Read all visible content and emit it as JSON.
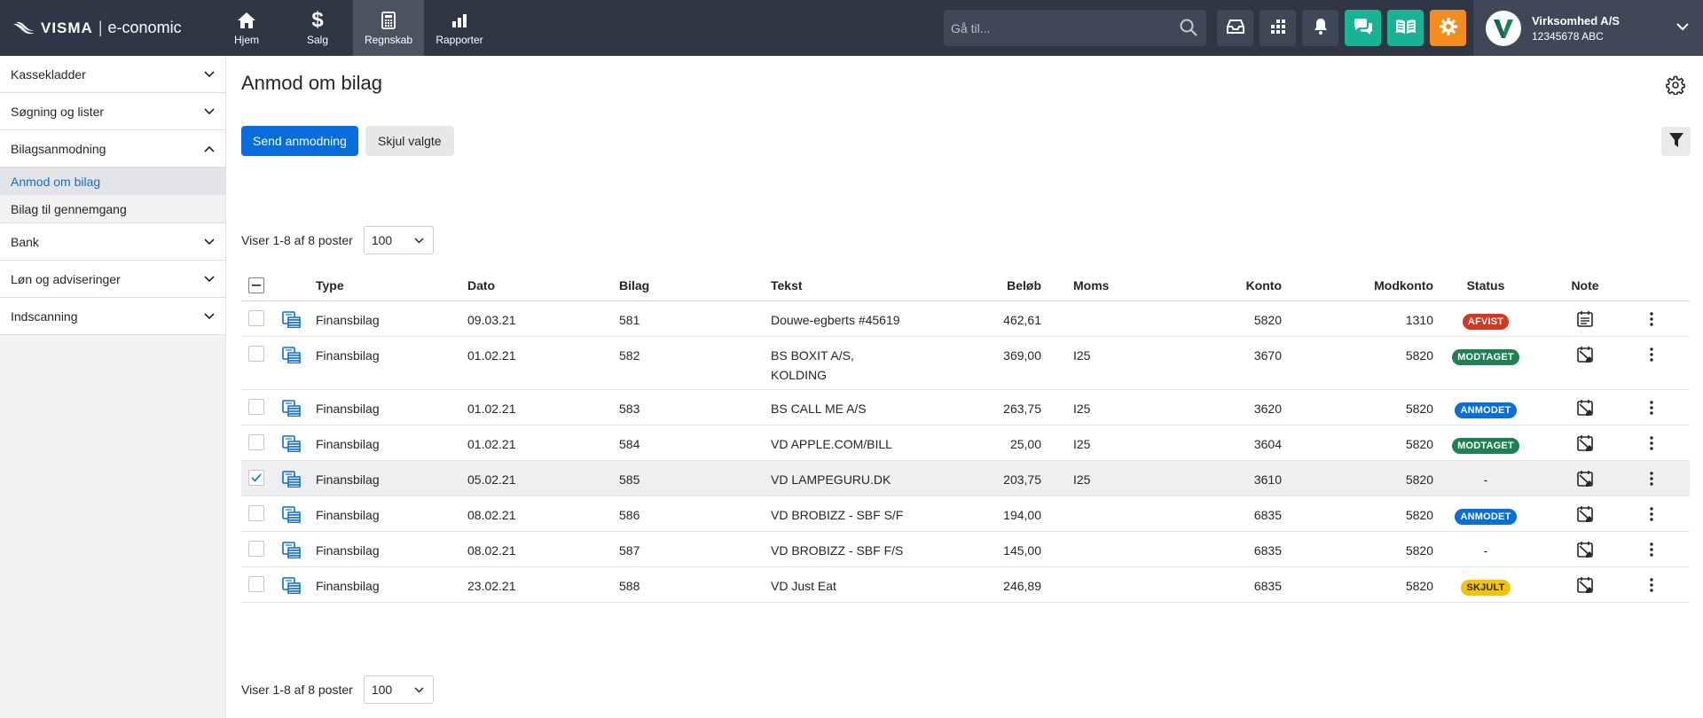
{
  "brand": {
    "visma": "VISMA",
    "sep": "|",
    "product": "e-conomic"
  },
  "topnav": [
    {
      "label": "Hjem",
      "icon": "home-icon"
    },
    {
      "label": "Salg",
      "icon": "dollar-icon"
    },
    {
      "label": "Regnskab",
      "icon": "calculator-icon",
      "active": true
    },
    {
      "label": "Rapporter",
      "icon": "bar-chart-icon"
    }
  ],
  "search": {
    "placeholder": "Gå til..."
  },
  "company": {
    "name": "Virksomhed A/S",
    "number": "12345678 ABC"
  },
  "sidebar": {
    "groups": [
      {
        "label": "Kassekladder"
      },
      {
        "label": "Søgning og lister"
      },
      {
        "label": "Bilagsanmodning",
        "expanded": true,
        "items": [
          {
            "label": "Anmod om bilag",
            "active": true
          },
          {
            "label": "Bilag til gennemgang"
          }
        ]
      },
      {
        "label": "Bank"
      },
      {
        "label": "Løn og adviseringer"
      },
      {
        "label": "Indscanning"
      }
    ]
  },
  "page": {
    "title": "Anmod om bilag"
  },
  "toolbar": {
    "send_label": "Send anmodning",
    "hide_label": "Skjul valgte"
  },
  "pager": {
    "text": "Viser 1-8 af 8 poster",
    "page_size": "100"
  },
  "table": {
    "columns": {
      "type": "Type",
      "dato": "Dato",
      "bilag": "Bilag",
      "tekst": "Tekst",
      "belob": "Beløb",
      "moms": "Moms",
      "konto": "Konto",
      "modkonto": "Modkonto",
      "status": "Status",
      "note": "Note"
    },
    "rows": [
      {
        "type": "Finansbilag",
        "dato": "09.03.21",
        "bilag": "581",
        "tekst1": "Douwe-egberts #45619",
        "tekst2": "",
        "belob": "462,61",
        "moms": "",
        "konto": "5820",
        "modkonto": "1310",
        "status": "AFVIST",
        "status_color": "#d6361f",
        "checked": false
      },
      {
        "type": "Finansbilag",
        "dato": "01.02.21",
        "bilag": "582",
        "tekst1": "BS BOXIT A/S,",
        "tekst2": "KOLDING",
        "belob": "369,00",
        "moms": "I25",
        "konto": "3670",
        "modkonto": "5820",
        "status": "MODTAGET",
        "status_color": "#1f8054",
        "checked": false
      },
      {
        "type": "Finansbilag",
        "dato": "01.02.21",
        "bilag": "583",
        "tekst1": "BS CALL ME A/S",
        "tekst2": "",
        "belob": "263,75",
        "moms": "I25",
        "konto": "3620",
        "modkonto": "5820",
        "status": "ANMODET",
        "status_color": "#0a6ddc",
        "checked": false
      },
      {
        "type": "Finansbilag",
        "dato": "01.02.21",
        "bilag": "584",
        "tekst1": "VD APPLE.COM/BILL",
        "tekst2": "",
        "belob": "25,00",
        "moms": "I25",
        "konto": "3604",
        "modkonto": "5820",
        "status": "MODTAGET",
        "status_color": "#1f8054",
        "checked": false
      },
      {
        "type": "Finansbilag",
        "dato": "05.02.21",
        "bilag": "585",
        "tekst1": "VD LAMPEGURU.DK",
        "tekst2": "",
        "belob": "203,75",
        "moms": "I25",
        "konto": "3610",
        "modkonto": "5820",
        "status": "-",
        "status_color": "",
        "checked": true
      },
      {
        "type": "Finansbilag",
        "dato": "08.02.21",
        "bilag": "586",
        "tekst1": "VD BROBIZZ - SBF S/F",
        "tekst2": "",
        "belob": "194,00",
        "moms": "",
        "konto": "6835",
        "modkonto": "5820",
        "status": "ANMODET",
        "status_color": "#0a6ddc",
        "checked": false
      },
      {
        "type": "Finansbilag",
        "dato": "08.02.21",
        "bilag": "587",
        "tekst1": "VD BROBIZZ - SBF F/S",
        "tekst2": "",
        "belob": "145,00",
        "moms": "",
        "konto": "6835",
        "modkonto": "5820",
        "status": "-",
        "status_color": "",
        "checked": false
      },
      {
        "type": "Finansbilag",
        "dato": "23.02.21",
        "bilag": "588",
        "tekst1": "VD Just Eat",
        "tekst2": "",
        "belob": "246,89",
        "moms": "",
        "konto": "6835",
        "modkonto": "5820",
        "status": "SKJULT",
        "status_color": "#f5c400",
        "status_text_color": "#252626",
        "checked": false
      }
    ]
  }
}
